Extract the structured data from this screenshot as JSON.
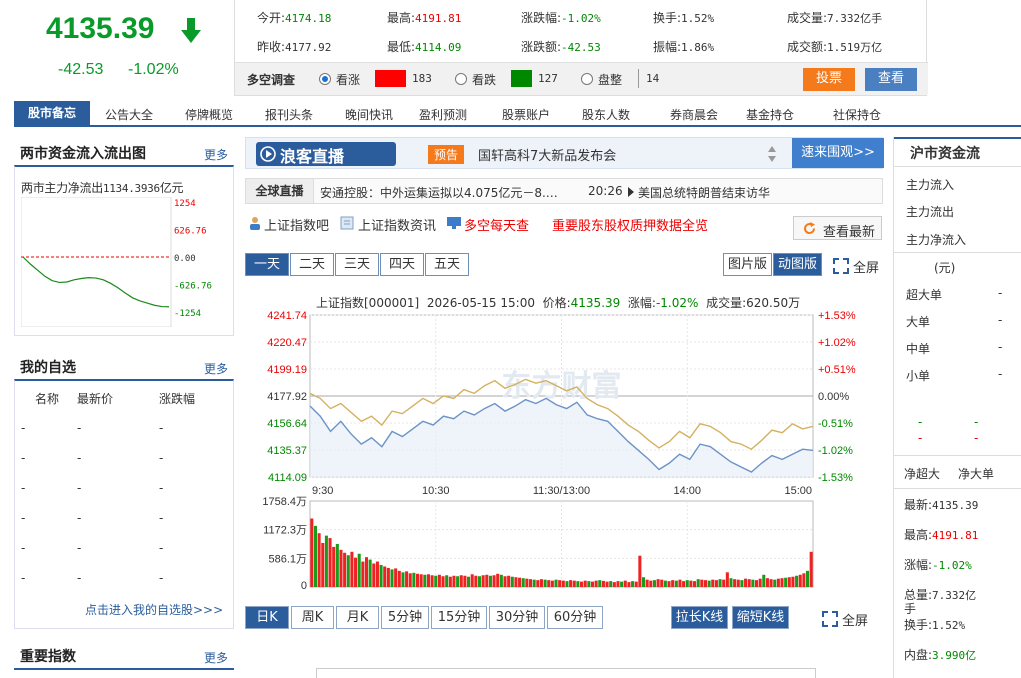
{
  "header": {
    "price": "4135.39",
    "change": "-42.53",
    "change_pct": "-1.02%",
    "quote": [
      {
        "label": "今开:",
        "value": "4174.18",
        "cls": "green"
      },
      {
        "label": "最高:",
        "value": "4191.81",
        "cls": "red"
      },
      {
        "label": "涨跌幅:",
        "value": "-1.02%",
        "cls": "green"
      },
      {
        "label": "换手:",
        "value": "1.52%",
        "cls": ""
      },
      {
        "label": "成交量:",
        "value": "7.332亿手",
        "cls": ""
      },
      {
        "label": "昨收:",
        "value": "4177.92",
        "cls": ""
      },
      {
        "label": "最低:",
        "value": "4114.09",
        "cls": "green"
      },
      {
        "label": "涨跌额:",
        "value": "-42.53",
        "cls": "green"
      },
      {
        "label": "振幅:",
        "value": "1.86%",
        "cls": ""
      },
      {
        "label": "成交额:",
        "value": "1.519万亿",
        "cls": ""
      }
    ],
    "poll": {
      "title": "多空调查",
      "bull": "看涨",
      "bull_count": "183",
      "bear": "看跌",
      "bear_count": "127",
      "flat": "盘整",
      "flat_count": "14",
      "vote_btn": "投票",
      "view_btn": "查看"
    }
  },
  "nav": {
    "first": "股市备忘",
    "items": [
      "公告大全",
      "停牌概览",
      "报刊头条",
      "晚间快讯",
      "盈利预测",
      "股票账户",
      "股东人数",
      "券商晨会",
      "基金持仓",
      "社保持仓"
    ]
  },
  "left": {
    "flow_title": "两市资金流入流出图",
    "more": "更多",
    "flow_label": "两市主力净流出",
    "flow_value": "1134.3936",
    "flow_unit": "亿元",
    "flow_ticks": [
      "1254",
      "626.76",
      "0.00",
      "-626.76",
      "-1254"
    ],
    "flow_series": [
      0,
      -160,
      -300,
      -440,
      -540,
      -580,
      -570,
      -520,
      -490,
      -470,
      -480,
      -520,
      -600,
      -700,
      -820,
      -930,
      -1000,
      -1050,
      -1100,
      -1130,
      -1134
    ],
    "watch_title": "我的自选",
    "watch_cols": [
      "名称",
      "最新价",
      "涨跌幅"
    ],
    "watch_empty": "-",
    "watch_link": "点击进入我的自选股>>>",
    "index_title": "重要指数"
  },
  "center": {
    "live_logo": "浪客直播",
    "live_tag": "预告",
    "live_text": "国轩高科7大新品发布会",
    "live_btn": "速来围观>>",
    "ticker_label": "全球直播",
    "ticker_text1": "安通控股：中外运集运拟以4.075亿元－8.…",
    "ticker_time": "20:26",
    "ticker_text2": "美国总统特朗普结束访华",
    "links": [
      "上证指数吧",
      "上证指数资讯",
      "多空每天查"
    ],
    "link_red": "重要股东股权质押数据全览",
    "refresh": "查看最新",
    "tabs": [
      "一天",
      "二天",
      "三天",
      "四天",
      "五天"
    ],
    "view_tabs": [
      "图片版",
      "动图版"
    ],
    "fullscreen": "全屏",
    "chart_info": {
      "name": "上证指数[000001]",
      "datetime": "2026-05-15 15:00",
      "price_label": "价格:",
      "price": "4135.39",
      "pct_label": "涨幅:",
      "pct": "-1.02%",
      "vol_label": "成交量:",
      "vol": "620.50万"
    },
    "watermark": "东方财富",
    "ktabs": [
      "日K",
      "周K",
      "月K",
      "5分钟",
      "15分钟",
      "30分钟",
      "60分钟"
    ],
    "kbtns": [
      "拉长K线",
      "缩短K线"
    ]
  },
  "chart_data": {
    "type": "line",
    "x_ticks": [
      "9:30",
      "10:30",
      "11:30/13:00",
      "14:00",
      "15:00"
    ],
    "y_left_ticks": [
      "4241.74",
      "4220.47",
      "4199.19",
      "4177.92",
      "4156.64",
      "4135.37",
      "4114.09"
    ],
    "y_right_ticks": [
      "+1.53%",
      "+1.02%",
      "+0.51%",
      "0.00%",
      "-0.51%",
      "-1.02%",
      "-1.53%"
    ],
    "ylim": [
      4114.09,
      4241.74
    ],
    "prev_close": 4177.92,
    "series": [
      {
        "color": "#6b93c5",
        "values": [
          4170,
          4162,
          4150,
          4158,
          4148,
          4140,
          4145,
          4138,
          4150,
          4146,
          4152,
          4158,
          4155,
          4162,
          4160,
          4166,
          4163,
          4168,
          4172,
          4166,
          4170,
          4175,
          4172,
          4176,
          4171,
          4168,
          4173,
          4163,
          4160,
          4158,
          4150,
          4142,
          4135,
          4128,
          4120,
          4125,
          4132,
          4128,
          4140,
          4138,
          4132,
          4126,
          4122,
          4118,
          4125,
          4131,
          4128,
          4132,
          4136,
          4135
        ]
      },
      {
        "color": "#d4b160",
        "values": [
          4180,
          4176,
          4168,
          4172,
          4165,
          4158,
          4162,
          4155,
          4166,
          4164,
          4170,
          4176,
          4172,
          4178,
          4176,
          4183,
          4180,
          4186,
          4190,
          4184,
          4187,
          4191,
          4188,
          4190,
          4186,
          4182,
          4185,
          4176,
          4171,
          4168,
          4162,
          4155,
          4150,
          4143,
          4137,
          4142,
          4150,
          4145,
          4156,
          4154,
          4149,
          4142,
          4140,
          4136,
          4143,
          4151,
          4149,
          4156,
          4152,
          4154
        ]
      }
    ],
    "vol_ticks": [
      "1758.4万",
      "1172.3万",
      "586.1万",
      "0"
    ],
    "vol_max": 1758.4,
    "volume": [
      1400,
      1250,
      1100,
      900,
      1050,
      1000,
      820,
      880,
      760,
      700,
      650,
      720,
      600,
      680,
      520,
      610,
      560,
      480,
      520,
      450,
      420,
      390,
      360,
      380,
      330,
      300,
      320,
      280,
      290,
      270,
      260,
      250,
      260,
      240,
      230,
      250,
      220,
      240,
      210,
      230,
      220,
      240,
      230,
      210,
      260,
      230,
      220,
      240,
      250,
      230,
      240,
      270,
      250,
      220,
      230,
      210,
      200,
      190,
      180,
      170,
      160,
      150,
      140,
      160,
      150,
      140,
      130,
      150,
      140,
      130,
      120,
      140,
      130,
      120,
      110,
      130,
      120,
      110,
      130,
      140,
      125,
      110,
      120,
      100,
      120,
      110,
      130,
      100,
      120,
      110,
      640,
      200,
      150,
      130,
      140,
      160,
      150,
      130,
      120,
      140,
      130,
      150,
      120,
      140,
      130,
      120,
      160,
      150,
      140,
      130,
      150,
      140,
      160,
      150,
      300,
      180,
      160,
      150,
      140,
      170,
      160,
      150,
      140,
      170,
      250,
      180,
      160,
      150,
      170,
      180,
      190,
      200,
      210,
      230,
      250,
      280,
      330,
      720
    ]
  },
  "right": {
    "title": "沪市资金流",
    "flows": [
      "主力流入",
      "主力流出",
      "主力净流入"
    ],
    "unit": "(元)",
    "rows": [
      "超大单",
      "大单",
      "中单",
      "小单"
    ],
    "dash": "-",
    "hdr": [
      "净超大",
      "净大单"
    ],
    "stats": [
      {
        "label": "最新:",
        "value": "4135.39",
        "cls": ""
      },
      {
        "label": "最高:",
        "value": "4191.81",
        "cls": "red"
      },
      {
        "label": "涨幅:",
        "value": "-1.02%",
        "cls": "green"
      },
      {
        "label": "总量:",
        "value": "7.332亿",
        "cls": ""
      },
      {
        "label": "换手:",
        "value": "1.52%",
        "cls": ""
      },
      {
        "label": "内盘:",
        "value": "3.990亿",
        "cls": "green"
      }
    ],
    "stat_suffix": "手"
  }
}
